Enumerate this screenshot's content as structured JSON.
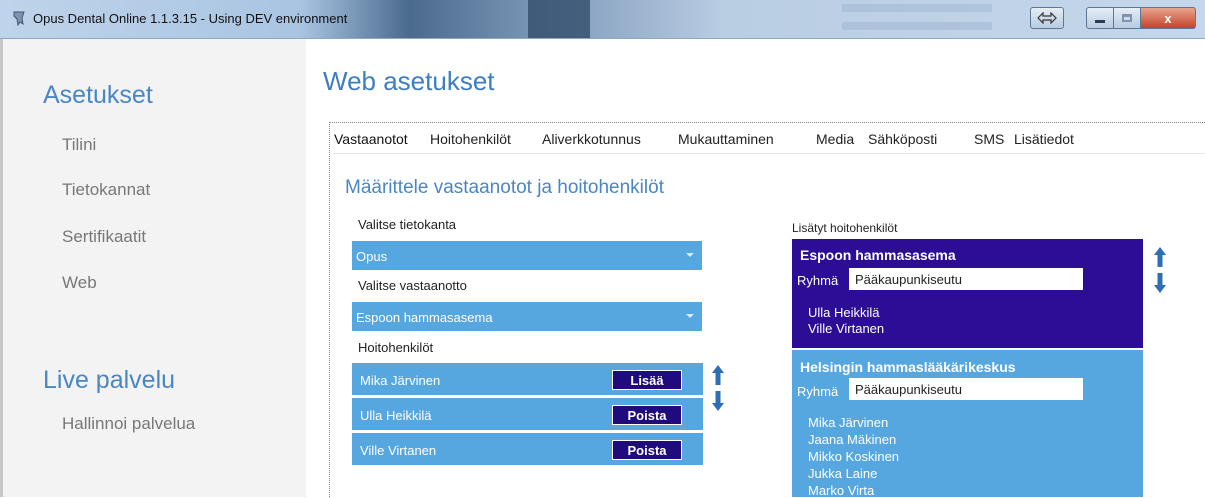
{
  "window": {
    "title": "Opus Dental Online 1.1.3.15 - Using DEV environment",
    "close_label": "x"
  },
  "sidebar": {
    "heading": "Asetukset",
    "items": [
      {
        "label": "Tilini"
      },
      {
        "label": "Tietokannat"
      },
      {
        "label": "Sertifikaatit"
      },
      {
        "label": "Web"
      }
    ],
    "live_heading": "Live palvelu",
    "live_items": [
      {
        "label": "Hallinnoi palvelua"
      }
    ]
  },
  "main": {
    "title": "Web asetukset",
    "tabs": [
      {
        "label": "Vastaanotot",
        "active": true
      },
      {
        "label": "Hoitohenkilöt"
      },
      {
        "label": "Aliverkkotunnus"
      },
      {
        "label": "Mukauttaminen"
      },
      {
        "label": "Media"
      },
      {
        "label": "Sähköposti"
      },
      {
        "label": "SMS"
      },
      {
        "label": "Lisätiedot"
      }
    ],
    "section_title": "Määrittele vastaanotot ja hoitohenkilöt",
    "database_label": "Valitse tietokanta",
    "database_value": "Opus",
    "clinic_label": "Valitse vastaanotto",
    "clinic_value": "Espoon hammasasema",
    "staff_label": "Hoitohenkilöt",
    "staff": [
      {
        "name": "Mika Järvinen",
        "action": "Lisää"
      },
      {
        "name": "Ulla Heikkilä",
        "action": "Poista"
      },
      {
        "name": "Ville Virtanen",
        "action": "Poista"
      }
    ],
    "added_label": "Lisätyt hoitohenkilöt",
    "groups": [
      {
        "title": "Espoon hammasasema",
        "group_label": "Ryhmä",
        "group_value": "Pääkaupunkiseutu",
        "members": [
          "Ulla Heikkilä",
          "Ville Virtanen"
        ]
      },
      {
        "title": "Helsingin hammaslääkärikeskus",
        "group_label": "Ryhmä",
        "group_value": "Pääkaupunkiseutu",
        "members": [
          "Mika Järvinen",
          "Jaana Mäkinen",
          "Mikko Koskinen",
          "Jukka Laine",
          "Marko Virta"
        ]
      }
    ]
  },
  "colors": {
    "accent_blue": "#4a86c5",
    "row_blue": "#56a7e0",
    "dark_indigo": "#2b0e95",
    "button_indigo": "#1f0b7e",
    "arrow_blue": "#2e6fb4"
  }
}
